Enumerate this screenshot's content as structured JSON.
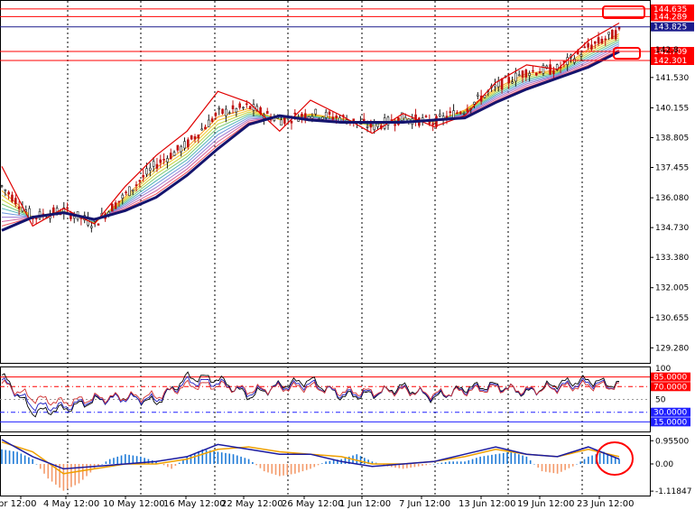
{
  "chart_data": [
    {
      "type": "line",
      "panel": "price",
      "description": "Candlestick price chart with moving-average ribbon and zigzag",
      "ylim": [
        128.6,
        145.0
      ],
      "y_ticks": [
        "141.530",
        "140.155",
        "138.805",
        "137.455",
        "136.080",
        "134.730",
        "133.380",
        "132.005",
        "130.655",
        "129.280"
      ],
      "highlight_levels": [
        {
          "label": "144.635",
          "value": 144.635,
          "color": "#ff0000"
        },
        {
          "label": "144.289",
          "value": 144.289,
          "color": "#ff0000"
        },
        {
          "label": "143.825",
          "value": 143.825,
          "color": "#1a1a8c"
        },
        {
          "label": "142.709",
          "value": 142.709,
          "color": "#ff0000"
        },
        {
          "label": "142.301",
          "value": 142.301,
          "color": "#ff0000"
        }
      ],
      "partial_tick_label": "142.8",
      "zigzag": {
        "color": "#e00000",
        "x": [
          0,
          2,
          4,
          6,
          8,
          10,
          12,
          14,
          16,
          18,
          20,
          22,
          24,
          26,
          28,
          30,
          32,
          34,
          36,
          38,
          40
        ],
        "y": [
          137.5,
          134.8,
          135.6,
          134.9,
          136.6,
          138.0,
          139.1,
          140.9,
          140.4,
          139.1,
          140.5,
          139.8,
          139.0,
          139.9,
          139.3,
          139.8,
          141.3,
          142.1,
          141.9,
          143.2,
          144.0
        ]
      },
      "ma_slow": {
        "color": "#14146e",
        "x": [
          0,
          2,
          4,
          6,
          8,
          10,
          12,
          14,
          16,
          18,
          20,
          22,
          24,
          26,
          28,
          30,
          32,
          34,
          36,
          38,
          40
        ],
        "y": [
          134.6,
          135.2,
          135.4,
          135.1,
          135.5,
          136.1,
          137.1,
          138.3,
          139.4,
          139.8,
          139.6,
          139.5,
          139.5,
          139.5,
          139.6,
          139.7,
          140.4,
          141.0,
          141.5,
          142.0,
          142.7
        ]
      },
      "price_ribbon_mid": {
        "x": [
          0,
          2,
          4,
          6,
          8,
          10,
          12,
          14,
          16,
          18,
          20,
          22,
          24,
          26,
          28,
          30,
          32,
          34,
          36,
          38,
          40
        ],
        "y": [
          136.6,
          135.2,
          135.5,
          134.9,
          136.2,
          137.6,
          138.5,
          139.9,
          140.2,
          139.6,
          139.9,
          139.7,
          139.3,
          139.7,
          139.5,
          140.1,
          141.1,
          141.8,
          141.9,
          142.9,
          143.6
        ]
      },
      "ribbon_colors": [
        "#f7a01e",
        "#f0c832",
        "#c8d23c",
        "#7ac86e",
        "#50b4b4",
        "#6e96dc",
        "#9a7ad2",
        "#d264a0",
        "#f0505a"
      ]
    },
    {
      "type": "line",
      "panel": "oscillator",
      "ylim": [
        0,
        100
      ],
      "top_label": "100",
      "mid_label": "50",
      "levels": [
        {
          "label": "85.0000",
          "value": 85,
          "color": "#ff0000",
          "style": "solid"
        },
        {
          "label": "70.0000",
          "value": 70,
          "color": "#ff0000",
          "style": "dash"
        },
        {
          "label": "30.0000",
          "value": 30,
          "color": "#2020ff",
          "style": "dash"
        },
        {
          "label": "15.0000",
          "value": 15,
          "color": "#2020ff",
          "style": "solid"
        }
      ],
      "series": [
        {
          "color": "#000000",
          "x": [
            0,
            2,
            4,
            6,
            8,
            10,
            12,
            14,
            16,
            18,
            20,
            22,
            24,
            26,
            28,
            30,
            32,
            34,
            36,
            38,
            40
          ],
          "y": [
            88,
            30,
            35,
            48,
            55,
            45,
            85,
            82,
            55,
            72,
            80,
            55,
            58,
            70,
            52,
            68,
            72,
            60,
            75,
            80,
            72
          ]
        },
        {
          "color": "#2020c0",
          "x": [
            0,
            2,
            4,
            6,
            8,
            10,
            12,
            14,
            16,
            18,
            20,
            22,
            24,
            26,
            28,
            30,
            32,
            34,
            36,
            38,
            40
          ],
          "y": [
            80,
            40,
            38,
            50,
            52,
            50,
            78,
            76,
            60,
            70,
            74,
            58,
            60,
            66,
            55,
            65,
            70,
            62,
            70,
            76,
            70
          ]
        },
        {
          "color": "#d03030",
          "x": [
            0,
            2,
            4,
            6,
            8,
            10,
            12,
            14,
            16,
            18,
            20,
            22,
            24,
            26,
            28,
            30,
            32,
            34,
            36,
            38,
            40
          ],
          "y": [
            75,
            52,
            45,
            52,
            54,
            55,
            72,
            72,
            64,
            68,
            70,
            62,
            62,
            64,
            58,
            63,
            68,
            64,
            68,
            72,
            70
          ]
        }
      ]
    },
    {
      "type": "bar",
      "panel": "macd",
      "ylim": [
        -1.3,
        1.15
      ],
      "y_ticks": [
        "0.95500",
        "0.00",
        "-1.11847"
      ],
      "histogram_x": [
        0,
        1,
        2,
        3,
        4,
        5,
        6,
        7,
        8,
        9,
        10,
        11,
        12,
        13,
        14,
        15,
        16,
        17,
        18,
        19,
        20,
        21,
        22,
        23,
        24,
        25,
        26,
        27,
        28,
        29,
        30,
        31,
        32,
        33,
        34,
        35,
        36,
        37,
        38,
        39,
        40
      ],
      "histogram_y": [
        0.6,
        0.5,
        0.2,
        -0.6,
        -1.1,
        -0.8,
        -0.2,
        0.2,
        0.4,
        0.3,
        0.1,
        -0.2,
        0.3,
        0.6,
        0.5,
        0.4,
        0.2,
        -0.3,
        -0.5,
        -0.4,
        -0.2,
        0.1,
        0.2,
        0.4,
        0.1,
        -0.1,
        -0.2,
        -0.1,
        0.0,
        0.1,
        0.1,
        0.3,
        0.4,
        0.5,
        0.3,
        -0.3,
        -0.4,
        -0.1,
        0.3,
        0.5,
        0.2
      ],
      "positive_color": "#1e7ad7",
      "negative_color": "#f49a6a",
      "signal_lines": [
        {
          "color": "#f0a000",
          "x": [
            0,
            2,
            4,
            6,
            8,
            10,
            12,
            14,
            16,
            18,
            20,
            22,
            24,
            26,
            28,
            30,
            32,
            34,
            36,
            38,
            40
          ],
          "y": [
            0.9,
            0.5,
            -0.4,
            -0.2,
            0.0,
            0.0,
            0.2,
            0.6,
            0.7,
            0.5,
            0.4,
            0.3,
            0.0,
            0.0,
            0.1,
            0.3,
            0.6,
            0.4,
            0.3,
            0.6,
            0.3
          ]
        },
        {
          "color": "#1a1aa0",
          "x": [
            0,
            2,
            4,
            6,
            8,
            10,
            12,
            14,
            16,
            18,
            20,
            22,
            24,
            26,
            28,
            30,
            32,
            34,
            36,
            38,
            40
          ],
          "y": [
            1.0,
            0.3,
            -0.2,
            -0.1,
            0.0,
            0.1,
            0.3,
            0.8,
            0.6,
            0.4,
            0.4,
            0.1,
            -0.1,
            0.0,
            0.1,
            0.4,
            0.7,
            0.4,
            0.3,
            0.7,
            0.2
          ]
        }
      ]
    }
  ],
  "x_axis": {
    "labels": [
      "pr 12:00",
      "4 May 12:00",
      "10 May 12:00",
      "16 May 12:00",
      "22 May 12:00",
      "26 May 12:00",
      "1 Jun 12:00",
      "7 Jun 12:00",
      "13 Jun 12:00",
      "19 Jun 12:00",
      "23 Jun 12:00"
    ]
  },
  "annotations": {
    "color": "#ff0000",
    "shapes": [
      "rounded-rectangle",
      "rounded-rectangle",
      "circle"
    ]
  }
}
